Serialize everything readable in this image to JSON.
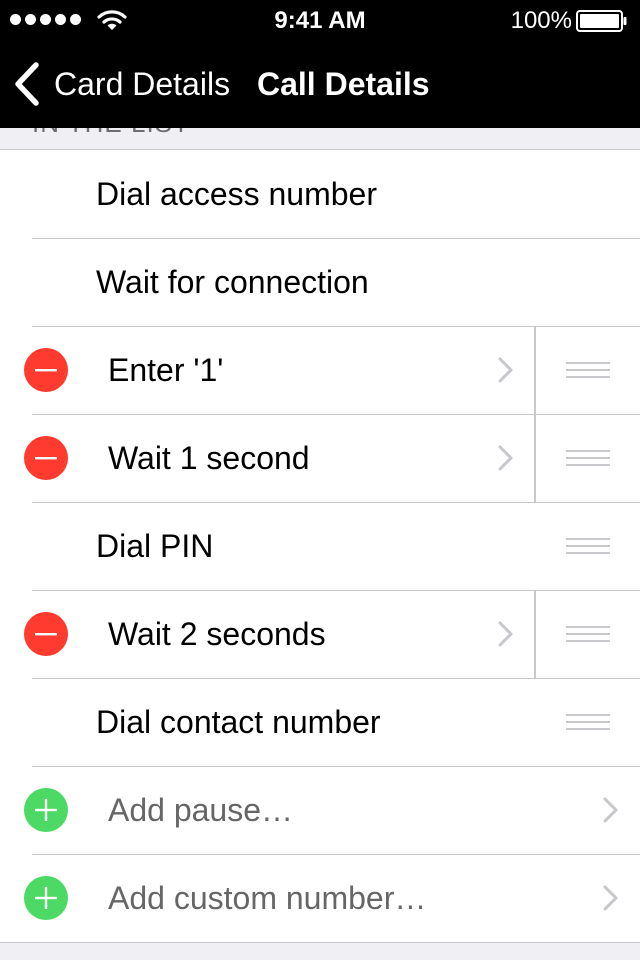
{
  "status_bar": {
    "time": "9:41 AM",
    "battery_percent": "100%",
    "signal_icon": "signal-dots-icon",
    "wifi_icon": "wifi-icon",
    "battery_icon": "battery-full-icon"
  },
  "nav": {
    "back_label": "Card Details",
    "title": "Call Details",
    "back_icon": "chevron-left-icon"
  },
  "section": {
    "header": "IN THE LIST"
  },
  "rows": [
    {
      "label": "Dial access number"
    },
    {
      "label": "Wait for connection"
    },
    {
      "label": "Enter '1'"
    },
    {
      "label": "Wait 1 second"
    },
    {
      "label": "Dial PIN"
    },
    {
      "label": "Wait 2 seconds"
    },
    {
      "label": "Dial contact number"
    },
    {
      "label": "Add pause…"
    },
    {
      "label": "Add custom number…"
    }
  ],
  "colors": {
    "delete": "#ff3b30",
    "add": "#4cd964",
    "separator": "#c8c7cc",
    "background": "#efeff4"
  }
}
